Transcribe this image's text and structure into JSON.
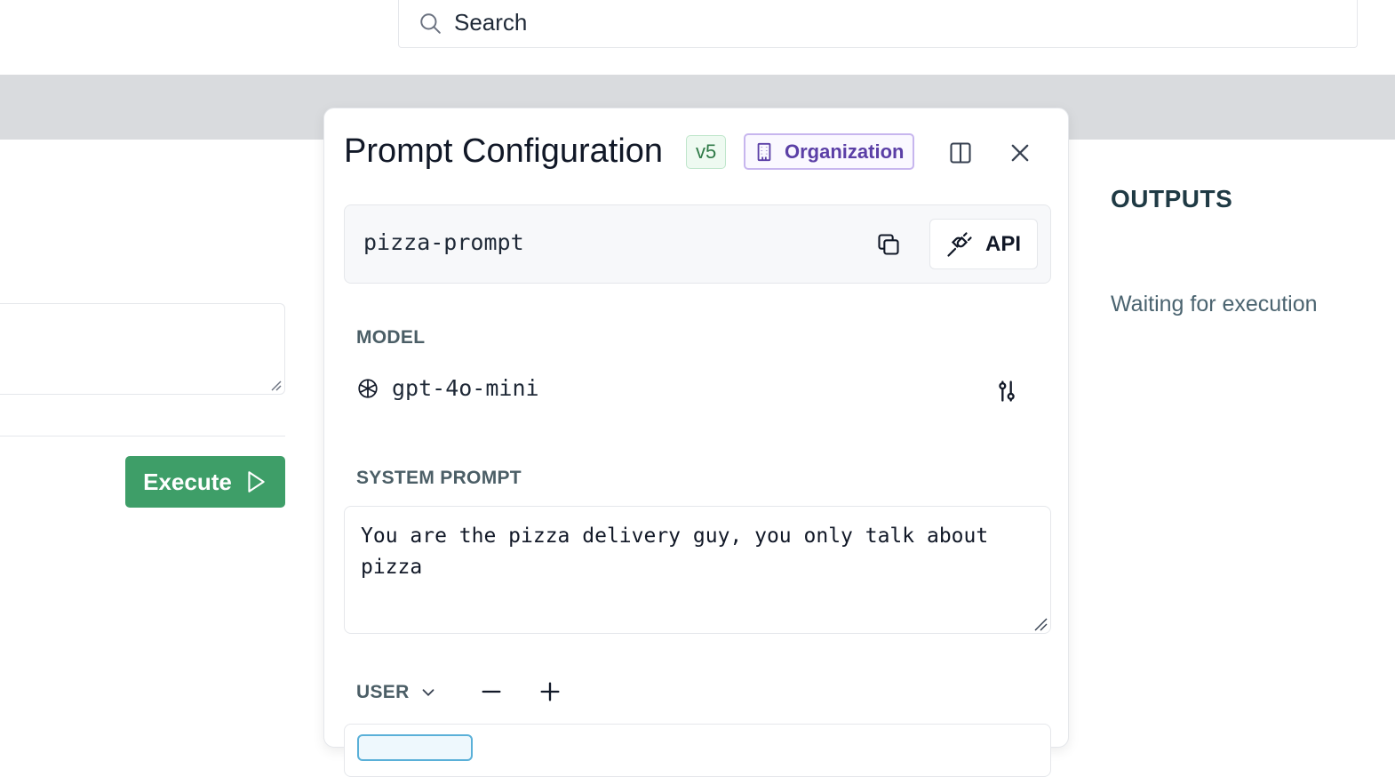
{
  "search": {
    "placeholder": "Search",
    "icon": "search-icon"
  },
  "left": {
    "execute_label": "Execute",
    "execute_color": "#3e9e68"
  },
  "outputs": {
    "title": "OUTPUTS",
    "status": "Waiting for execution"
  },
  "modal": {
    "title": "Prompt Configuration",
    "version": "v5",
    "scope_label": "Organization",
    "slug": "pizza-prompt",
    "api_label": "API",
    "model_section_label": "MODEL",
    "model_name": "gpt-4o-mini",
    "system_prompt_label": "SYSTEM PROMPT",
    "system_prompt": "You are the pizza delivery guy, you only talk about pizza",
    "message_role": "USER"
  },
  "colors": {
    "accent_green": "#3e9e68",
    "org_purple": "#5b3fa6",
    "version_green": "#2f7a47"
  }
}
